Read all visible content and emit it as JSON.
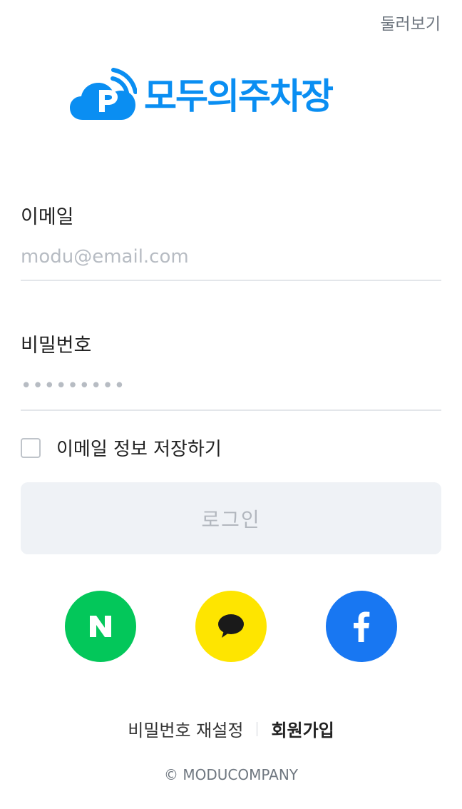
{
  "header": {
    "browse_label": "둘러보기"
  },
  "logo": {
    "text": "모두의주차장",
    "color": "#0a8ef2"
  },
  "login_form": {
    "email_label": "이메일",
    "email_placeholder": "modu@email.com",
    "password_label": "비밀번호",
    "password_placeholder": "•••••••••",
    "remember_label": "이메일 정보 저장하기",
    "remember_checked": false,
    "login_button_label": "로그인"
  },
  "social_login": [
    {
      "provider": "naver",
      "icon": "naver-n-icon",
      "color": "#03c75a"
    },
    {
      "provider": "kakao",
      "icon": "speech-bubble-icon",
      "color": "#fee500"
    },
    {
      "provider": "facebook",
      "icon": "facebook-f-icon",
      "color": "#1877f2"
    }
  ],
  "footer": {
    "reset_password_label": "비밀번호 재설정",
    "signup_label": "회원가입",
    "copyright": "© MODUCOMPANY"
  }
}
